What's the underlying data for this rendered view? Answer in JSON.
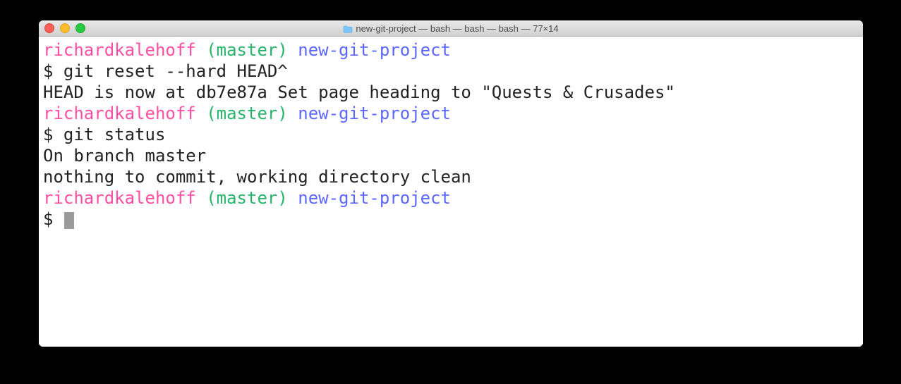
{
  "window": {
    "title": "new-git-project — bash — bash — bash — 77×14",
    "folder_icon": "folder-icon"
  },
  "colors": {
    "user": "#ff4fa2",
    "branch": "#28b36a",
    "dir": "#5b67ff",
    "text": "#222222"
  },
  "prompt": {
    "user": "richardkalehoff",
    "branch": "(master)",
    "dir": "new-git-project",
    "symbol": "$"
  },
  "lines": [
    {
      "type": "prompt"
    },
    {
      "type": "cmd",
      "text": "git reset --hard HEAD^"
    },
    {
      "type": "out",
      "text": "HEAD is now at db7e87a Set page heading to \"Quests & Crusades\""
    },
    {
      "type": "prompt"
    },
    {
      "type": "cmd",
      "text": "git status"
    },
    {
      "type": "out",
      "text": "On branch master"
    },
    {
      "type": "out",
      "text": "nothing to commit, working directory clean"
    },
    {
      "type": "prompt"
    },
    {
      "type": "cursor"
    }
  ]
}
